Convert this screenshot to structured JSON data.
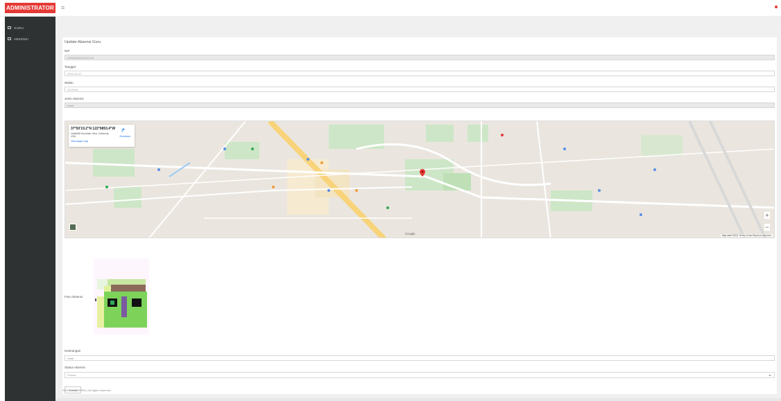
{
  "app": {
    "brand": "ADMINISTRATOR"
  },
  "sidebar": {
    "items": [
      {
        "label": "GURU"
      },
      {
        "label": "ABSENSI"
      }
    ]
  },
  "form": {
    "title": "Update Absensi Guru",
    "nip_label": "NIP",
    "nip_value": "199105052020011S6",
    "tanggal_label": "Tanggal",
    "tanggal_value": "2021-01-27",
    "waktu_label": "Waktu",
    "waktu_value": "14:29:54",
    "jenis_label": "Jenis Absensi",
    "jenis_value": "Hadir",
    "foto_label": "Foto Absensi",
    "keterangan_label": "Keterangan",
    "keterangan_value": "Hadir",
    "status_label": "Status Absensi",
    "status_value": "Proses",
    "submit_label": "Submit"
  },
  "map": {
    "coords": "37°50'19.2\"N 122°0853.4\"W",
    "address": "Unit8638 Mountain View, California, USA",
    "directions_label": "Directions",
    "view_larger": "View larger map",
    "google": "Google",
    "footer_text": "Map data ©2021   Terms of Use   Report a map error",
    "zoom_in": "+",
    "zoom_out": "−"
  },
  "footer": {
    "text": "SDN 219 BARERU | All rights reserved."
  },
  "colors": {
    "brand_red": "#e53935",
    "sidebar_bg": "#2f3232",
    "content_bg": "#f0f0f0",
    "map_pin": "#e53935"
  },
  "icons": {
    "menu": "hamburger-icon",
    "sidebar_item": "checkbox-icon",
    "directions": "directions-icon",
    "map_pin": "map-pin-icon",
    "select": "chevron-down-icon"
  }
}
